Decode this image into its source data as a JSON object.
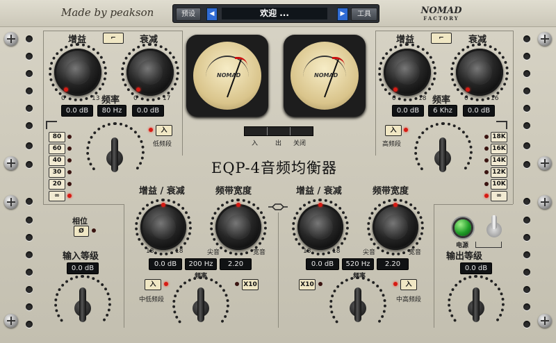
{
  "header": {
    "brand": "Made by peakson",
    "preset_label": "预设",
    "preset_name": "欢迎 ...",
    "tools_label": "工具",
    "logo_text": "NOMAD",
    "logo_sub": "FACTORY"
  },
  "title": "EQP-4音频均衡器",
  "meters": {
    "switch": [
      "入",
      "出",
      "关闭"
    ],
    "logo": "NOMAD"
  },
  "low_section": {
    "boost_label": "增益",
    "atten_label": "衰减",
    "freq_label": "频率",
    "boost_value": "0.0 dB",
    "freq_value": "80 Hz",
    "atten_value": "0.0 dB",
    "boost_scale_min": "0",
    "boost_scale_max": "13",
    "atten_scale_min": "0",
    "atten_scale_max": "17",
    "in_button": "入",
    "band_label": "低频段",
    "freqs": [
      "80",
      "60",
      "40",
      "30",
      "20",
      "∞"
    ]
  },
  "high_section": {
    "boost_label": "增益",
    "atten_label": "衰减",
    "freq_label": "频率",
    "boost_value": "0.0 dB",
    "freq_value": "6 Khz",
    "atten_value": "0.0 dB",
    "boost_scale_min": "0",
    "boost_scale_max": "18",
    "atten_scale_min": "0",
    "atten_scale_max": "16",
    "in_button": "入",
    "band_label": "高频段",
    "freqs": [
      "18K",
      "16K",
      "14K",
      "12K",
      "10K",
      "∞"
    ]
  },
  "input": {
    "phase_label": "相位",
    "phase_button": "Ø",
    "level_label": "输入等级",
    "level_value": "0.0 dB"
  },
  "mid_low": {
    "gain_label": "增益 / 衰减",
    "bw_label": "频带宽度",
    "gain_min": "18",
    "gain_max": "18",
    "bw_left": "尖音",
    "bw_right": "宽音",
    "gain_value": "0.0 dB",
    "freq_value": "200 Hz",
    "bw_value": "2.20",
    "in_button": "入",
    "band_label": "中低频段",
    "freq_label": "频率",
    "x10_button": "X10"
  },
  "mid_high": {
    "gain_label": "增益 / 衰减",
    "bw_label": "频带宽度",
    "gain_min": "18",
    "gain_max": "18",
    "bw_left": "尖音",
    "bw_right": "宽音",
    "gain_value": "0.0 dB",
    "freq_value": "520 Hz",
    "bw_value": "2.20",
    "in_button": "入",
    "band_label": "中高频段",
    "freq_label": "频率",
    "x10_button": "X10"
  },
  "output": {
    "power_label": "电源",
    "level_label": "输出等级",
    "level_value": "0.0 dB"
  },
  "colors": {
    "panel": "#cdc9ba",
    "led_on": "#d51b14",
    "power": "#1f9d27",
    "preset_arrow": "#2f6bd4"
  }
}
